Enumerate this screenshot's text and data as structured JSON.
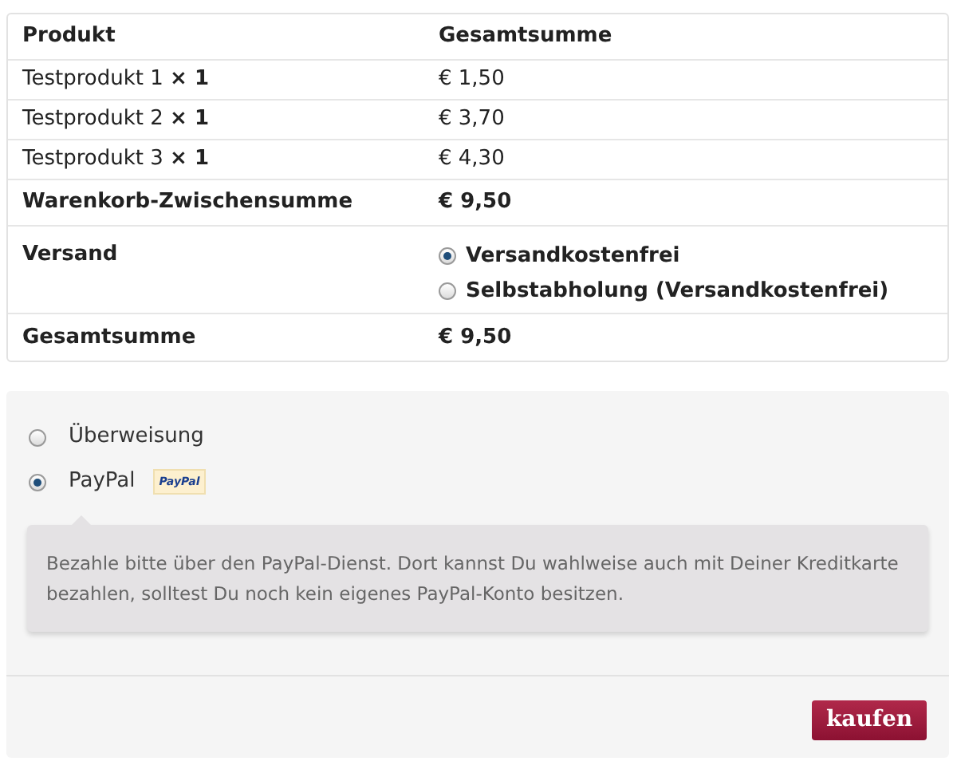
{
  "table": {
    "columns": [
      "Produkt",
      "Gesamtsumme"
    ],
    "rows": [
      {
        "product": "Testprodukt 1 **× 1**",
        "total": "€ 1,50"
      },
      {
        "product": "Testprodukt 2 **× 1**",
        "total": "€ 3,70"
      },
      {
        "product": "Testprodukt 3 **× 1**",
        "total": "€ 4,30"
      }
    ],
    "subtotal": {
      "label": "Warenkorb-Zwischensumme",
      "value": "€ 9,50"
    },
    "shipping": {
      "label": "Versand",
      "options": [
        {
          "label": "Versandkostenfrei",
          "selected": true
        },
        {
          "label": "Selbstabholung (Versandkostenfrei)",
          "selected": false
        }
      ]
    },
    "total": {
      "label": "Gesamtsumme",
      "value": "€ 9,50"
    }
  },
  "payment": {
    "methods": [
      {
        "label": "Überweisung",
        "selected": false
      },
      {
        "label": "PayPal",
        "selected": true,
        "logo_text": "PayPal"
      }
    ],
    "description": "Bezahle bitte über den PayPal-Dienst. Dort kannst Du wahlweise auch mit Deiner Kreditkarte bezahlen, solltest Du noch kein eigenes PayPal-Konto besitzen.",
    "button": "kaufen"
  }
}
